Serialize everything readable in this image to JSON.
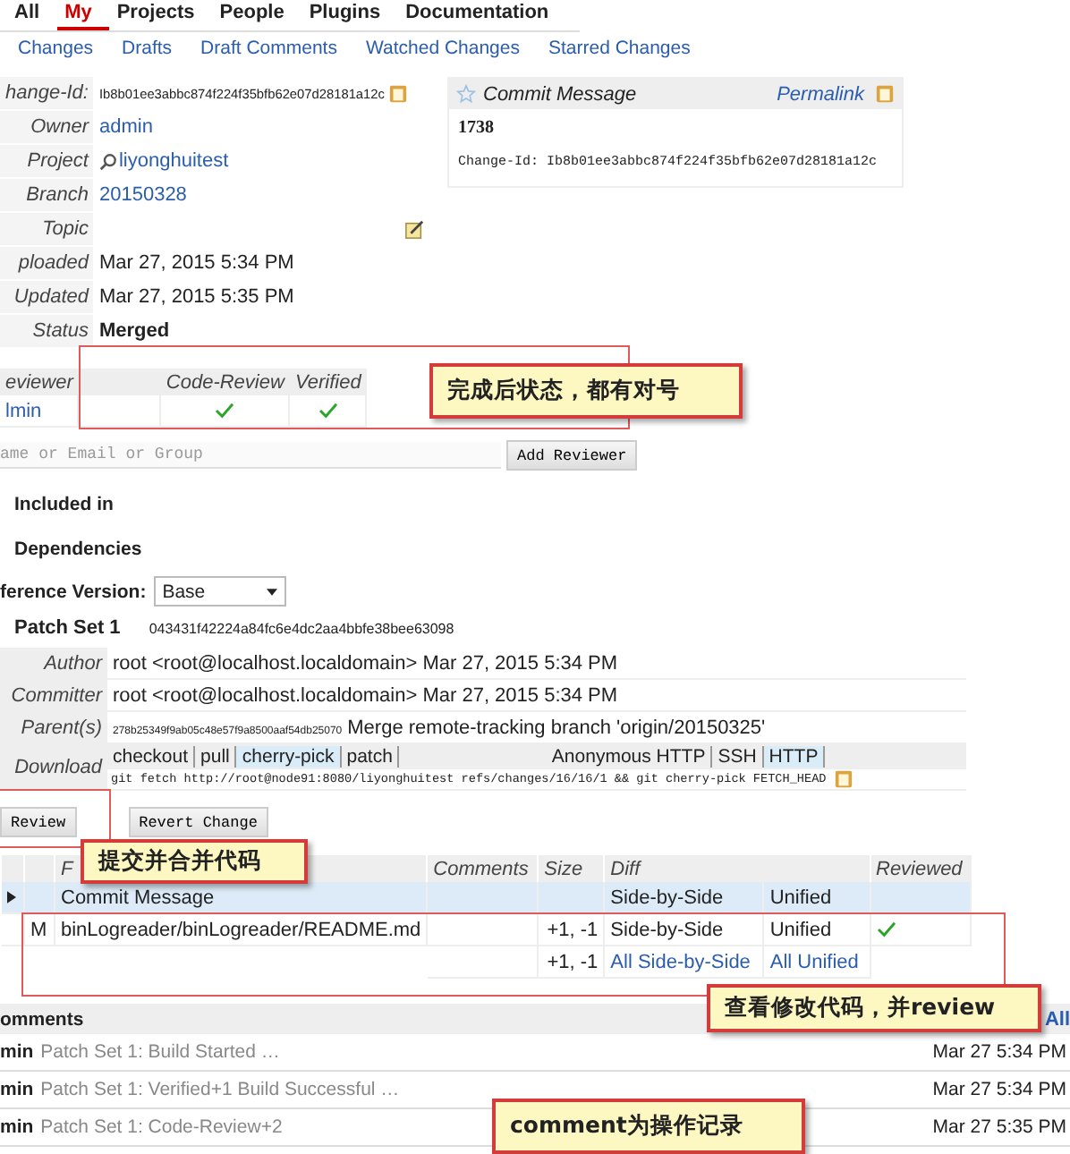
{
  "top_tabs": [
    {
      "label": "All",
      "selected": false
    },
    {
      "label": "My",
      "selected": true
    },
    {
      "label": "Projects",
      "selected": false
    },
    {
      "label": "People",
      "selected": false
    },
    {
      "label": "Plugins",
      "selected": false
    },
    {
      "label": "Documentation",
      "selected": false
    }
  ],
  "sub_tabs": [
    "Changes",
    "Drafts",
    "Draft Comments",
    "Watched Changes",
    "Starred Changes"
  ],
  "change_info": [
    {
      "label": "hange-Id:",
      "value": "Ib8b01ee3abbc874f224f35bfb62e07d28181a12c",
      "kind": "id"
    },
    {
      "label": "Owner",
      "value": "admin",
      "kind": "link"
    },
    {
      "label": "Project",
      "value": "liyonghuitest",
      "kind": "project"
    },
    {
      "label": "Branch",
      "value": "20150328",
      "kind": "link"
    },
    {
      "label": "Topic",
      "kind": "topic"
    },
    {
      "label": "ploaded",
      "value": "Mar 27, 2015 5:34 PM",
      "kind": "text"
    },
    {
      "label": "Updated",
      "value": "Mar 27, 2015 5:35 PM",
      "kind": "text"
    },
    {
      "label": "Status",
      "value": "Merged",
      "kind": "status"
    }
  ],
  "commit_message": {
    "title": "Commit Message",
    "permalink": "Permalink",
    "subject": "1738",
    "footer": "Change-Id: Ib8b01ee3abbc874f224f35bfb62e07d28181a12c"
  },
  "reviewers": {
    "columns": [
      "eviewer",
      "Code-Review",
      "Verified"
    ],
    "rows": [
      {
        "name": "lmin",
        "code_review": true,
        "verified": true
      }
    ]
  },
  "add_reviewer": {
    "placeholder": "ame or Email or Group",
    "button": "Add Reviewer"
  },
  "sections": [
    "Included in",
    "Dependencies"
  ],
  "reference_version": {
    "label": "ference Version:",
    "value": "Base"
  },
  "patch_set": {
    "title": "Patch Set 1",
    "commit": "043431f42224a84fc6e4dc2aa4bbfe38bee63098",
    "rows": [
      {
        "label": "Author",
        "value": "root <root@localhost.localdomain> Mar 27, 2015 5:34 PM"
      },
      {
        "label": "Committer",
        "value": "root <root@localhost.localdomain> Mar 27, 2015 5:34 PM"
      },
      {
        "label": "Parent(s)",
        "hash": "278b25349f9ab05c48e57f9a8500aaf54db25070",
        "value": "Merge remote-tracking branch 'origin/20150325'"
      }
    ],
    "download": {
      "label": "Download",
      "schemes": [
        {
          "label": "checkout",
          "selected": false
        },
        {
          "label": "pull",
          "selected": false
        },
        {
          "label": "cherry-pick",
          "selected": true
        },
        {
          "label": "patch",
          "selected": false
        }
      ],
      "protocols": [
        {
          "label": "Anonymous HTTP",
          "selected": false
        },
        {
          "label": "SSH",
          "selected": false
        },
        {
          "label": "HTTP",
          "selected": true
        }
      ],
      "command": "git fetch http://root@node91:8080/liyonghuitest refs/changes/16/16/1 && git cherry-pick FETCH_HEAD"
    }
  },
  "actions": [
    "Review",
    "Revert Change"
  ],
  "files": {
    "columns": [
      "F",
      "Comments",
      "Size",
      "Diff",
      "Reviewed"
    ],
    "rows": [
      {
        "kind": "commit",
        "path": "Commit Message",
        "side": "Side-by-Side",
        "unified": "Unified",
        "reviewed": false
      },
      {
        "kind": "file",
        "status": "M",
        "path": "binLogreader/binLogreader/README.md",
        "size": "+1, -1",
        "side": "Side-by-Side",
        "unified": "Unified",
        "reviewed": true
      },
      {
        "kind": "total",
        "size": "+1, -1",
        "side": "All Side-by-Side",
        "unified": "All Unified"
      }
    ]
  },
  "comments": {
    "title": "omments",
    "link": "All",
    "items": [
      {
        "author": "min",
        "text": "Patch Set 1: Build Started …",
        "time": "Mar 27 5:34 PM"
      },
      {
        "author": "min",
        "text": "Patch Set 1: Verified+1 Build Successful …",
        "time": "Mar 27 5:34 PM"
      },
      {
        "author": "min",
        "text": "Patch Set 1: Code-Review+2",
        "time": "Mar 27 5:35 PM"
      }
    ]
  },
  "annotations": [
    {
      "text": "完成后状态，都有对号"
    },
    {
      "text": "提交并合并代码"
    },
    {
      "text": "查看修改代码，并review"
    },
    {
      "text": "comment为操作记录"
    }
  ]
}
